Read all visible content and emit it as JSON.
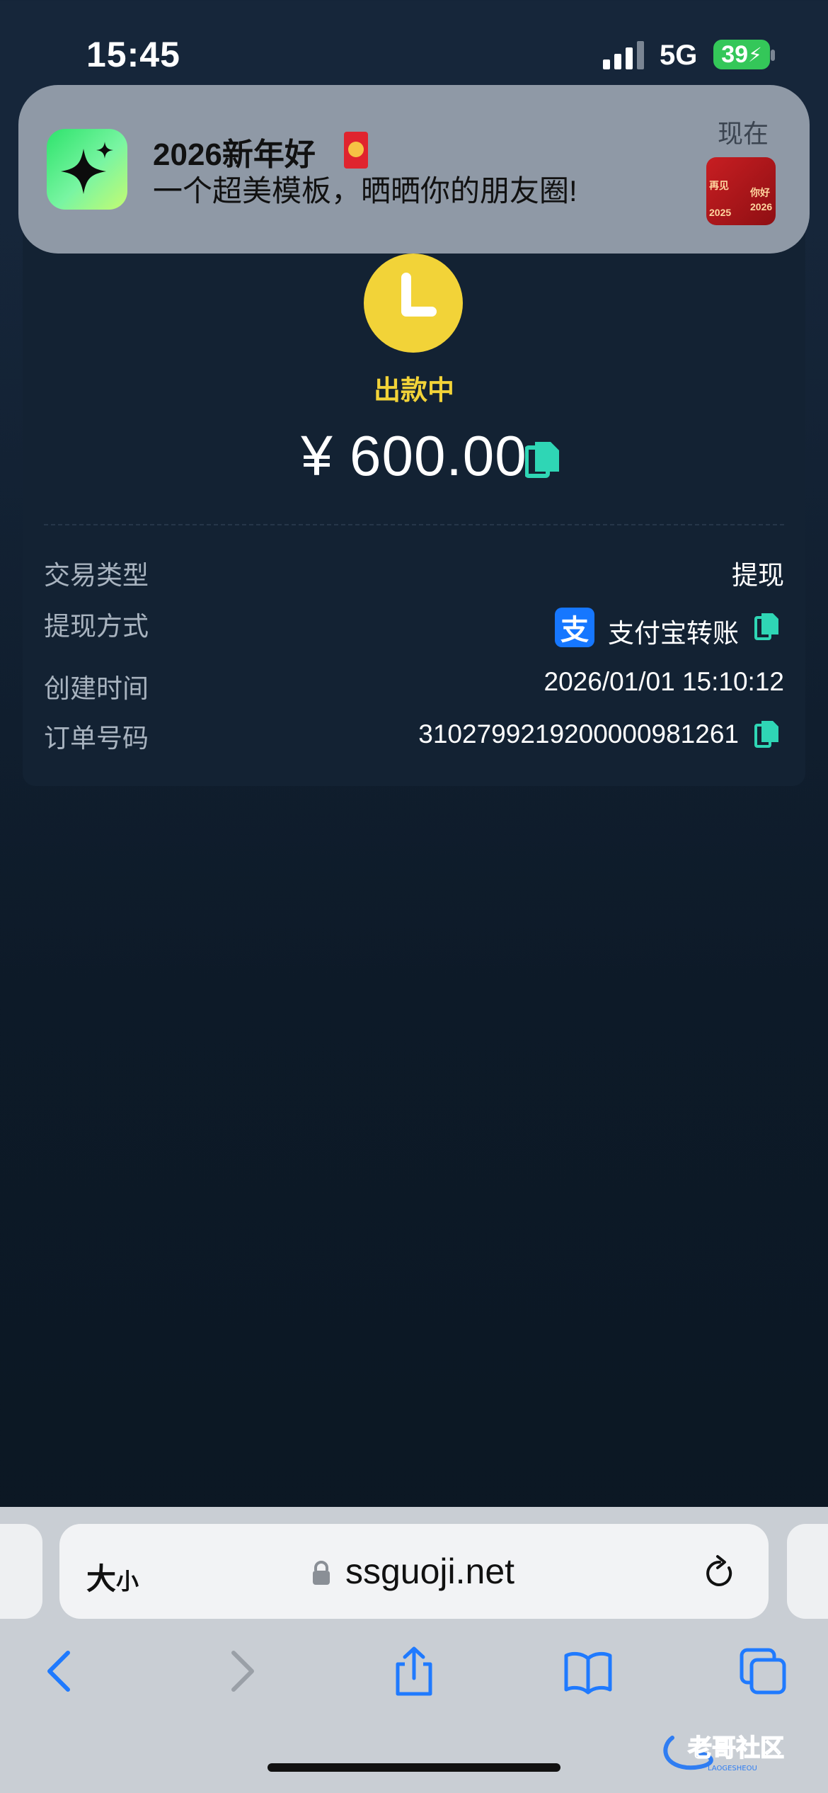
{
  "status_bar": {
    "time": "15:45",
    "network": "5G",
    "battery": "39"
  },
  "notification": {
    "title": "2026新年好",
    "body": "一个超美模板，晒晒你的朋友圈!",
    "time": "现在",
    "thumb_texts": [
      "再见",
      "2025",
      "你好",
      "2026"
    ]
  },
  "order": {
    "status": "出款中",
    "amount": "¥ 600.00",
    "rows": [
      {
        "label": "交易类型",
        "value": "提现"
      },
      {
        "label": "提现方式",
        "value": "支付宝转账"
      },
      {
        "label": "创建时间",
        "value": "2026/01/01 15:10:12"
      },
      {
        "label": "订单号码",
        "value": "3102799219200000981261"
      }
    ],
    "alipay_logo_char": "支"
  },
  "browser": {
    "text_size_big": "大",
    "text_size_small": "小",
    "url": "ssguoji.net"
  },
  "watermark": {
    "text": "老哥社区",
    "sub": "LAOGESHEOU"
  },
  "colors": {
    "accent_yellow": "#f2d338",
    "copy_icon": "#2fd6b5",
    "ios_blue": "#1f7aff",
    "battery_green": "#34c759"
  },
  "icons": [
    "clock-icon",
    "copy-icon",
    "lock-icon",
    "reload-icon",
    "back-icon",
    "forward-icon",
    "share-icon",
    "bookmarks-icon",
    "tabs-icon"
  ]
}
